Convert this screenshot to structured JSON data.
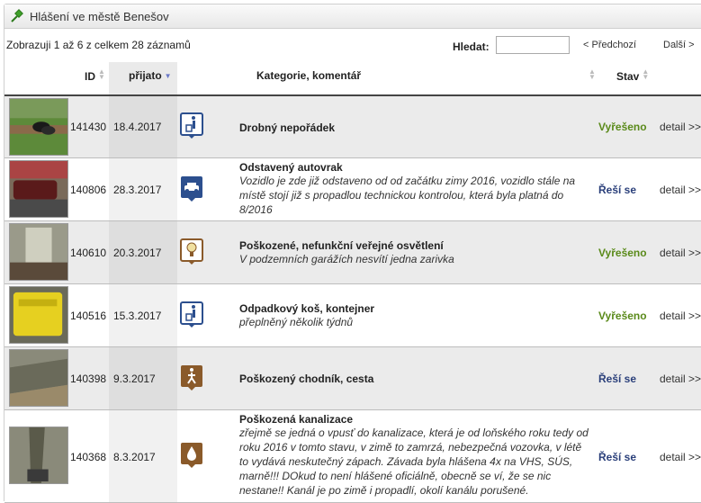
{
  "title": "Hlášení ve městě Benešov",
  "info": "Zobrazuji 1 až 6 z celkem 28 záznamů",
  "search": {
    "label": "Hledat:",
    "value": ""
  },
  "pager": {
    "prev": "< Předchozí",
    "next": "Další >"
  },
  "columns": {
    "id": "ID",
    "date": "přijato",
    "category": "Kategorie, komentář",
    "status": "Stav"
  },
  "rows": [
    {
      "id": "141430",
      "date": "18.4.2017",
      "icon": "trash-person-icon",
      "title": "Drobný nepořádek",
      "comment": "",
      "status": "Vyřešeno",
      "detail": "detail >>"
    },
    {
      "id": "140806",
      "date": "28.3.2017",
      "icon": "car-icon",
      "title": "Odstavený autovrak",
      "comment": "Vozidlo je zde již odstaveno od od začátku zimy 2016, vozidlo stále na místě stojí již s propadlou technickou kontrolou, která byla platná do 8/2016",
      "status": "Řeší se",
      "detail": "detail >>"
    },
    {
      "id": "140610",
      "date": "20.3.2017",
      "icon": "lightbulb-icon",
      "title": "Poškozené, nefunkční veřejné osvětlení",
      "comment": "V podzemních garážích nesvítí jedna zarivka",
      "status": "Vyřešeno",
      "detail": "detail >>"
    },
    {
      "id": "140516",
      "date": "15.3.2017",
      "icon": "trash-person-icon",
      "title": "Odpadkový koš, kontejner",
      "comment": "přeplněný několik týdnů",
      "status": "Vyřešeno",
      "detail": "detail >>"
    },
    {
      "id": "140398",
      "date": "9.3.2017",
      "icon": "pedestrian-icon",
      "title": "Poškozený chodník, cesta",
      "comment": "",
      "status": "Řeší se",
      "detail": "detail >>"
    },
    {
      "id": "140368",
      "date": "8.3.2017",
      "icon": "water-drop-icon",
      "title": "Poškozená kanalizace",
      "comment": "zřejmě se jedná o vpusť do kanalizace, která je od loňského roku tedy od roku 2016 v tomto stavu, v zimě to zamrzá, nebezpečná vozovka, v létě to vydává neskutečný zápach. Závada byla hlášena 4x na VHS, SÚS, marně!!! DOkud to není hlášené oficiálně, obecně se ví, že se nic nestane!! Kanál je po zimě i propadlí, okolí kanálu porušené.",
      "status": "Řeší se",
      "detail": "detail >>"
    }
  ]
}
